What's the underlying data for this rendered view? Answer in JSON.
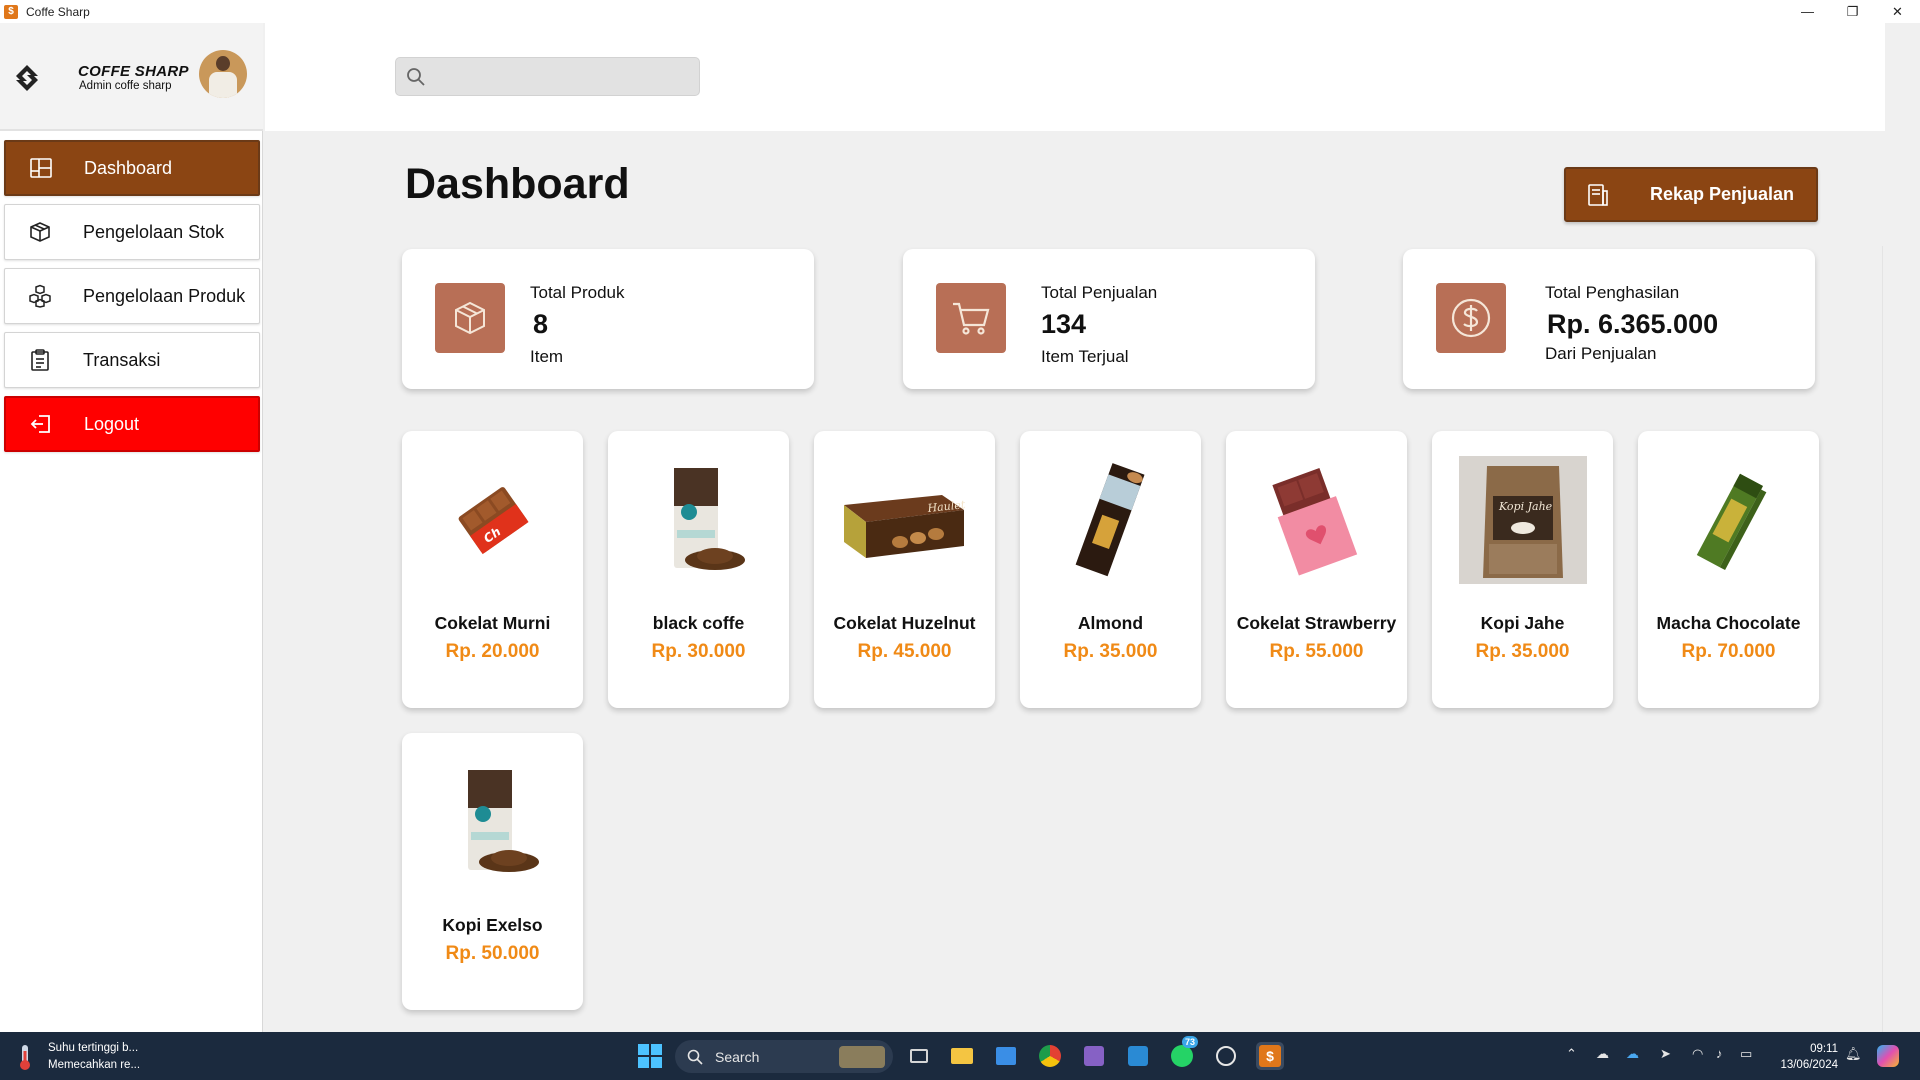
{
  "window": {
    "title": "Coffe Sharp",
    "minimize": "—",
    "maximize": "❐",
    "close": "✕"
  },
  "brand": {
    "name": "COFFE SHARP",
    "subtitle": "Admin coffe sharp"
  },
  "sidebar": {
    "items": [
      {
        "label": "Dashboard",
        "icon": "dashboard-icon",
        "active": true
      },
      {
        "label": "Pengelolaan Stok",
        "icon": "box-icon"
      },
      {
        "label": "Pengelolaan Produk",
        "icon": "boxes-icon"
      },
      {
        "label": "Transaksi",
        "icon": "clipboard-icon"
      },
      {
        "label": "Logout",
        "icon": "logout-icon"
      }
    ]
  },
  "search": {
    "value": "",
    "placeholder": ""
  },
  "page": {
    "title": "Dashboard",
    "rekap_label": "Rekap Penjualan"
  },
  "stats": [
    {
      "label": "Total Produk",
      "value": "8",
      "unit": "Item",
      "icon": "package-icon"
    },
    {
      "label": "Total Penjualan",
      "value": "134",
      "unit": "Item Terjual",
      "icon": "cart-icon"
    },
    {
      "label": "Total Penghasilan",
      "value": "Rp. 6.365.000",
      "unit": "Dari Penjualan",
      "icon": "dollar-icon"
    }
  ],
  "products": [
    {
      "name": "Cokelat Murni",
      "price": "Rp. 20.000"
    },
    {
      "name": "black coffe",
      "price": "Rp. 30.000"
    },
    {
      "name": "Cokelat Huzelnut",
      "price": "Rp. 45.000"
    },
    {
      "name": "Almond",
      "price": "Rp. 35.000"
    },
    {
      "name": "Cokelat Strawberry",
      "price": "Rp. 55.000"
    },
    {
      "name": "Kopi Jahe",
      "price": "Rp. 35.000"
    },
    {
      "name": "Macha Chocolate",
      "price": "Rp. 70.000"
    },
    {
      "name": "Kopi Exelso",
      "price": "Rp. 50.000"
    }
  ],
  "taskbar": {
    "weather_line1": "Suhu tertinggi b...",
    "weather_line2": "Memecahkan re...",
    "search_label": "Search",
    "whatsapp_badge": "73",
    "time": "09:11",
    "date": "13/06/2024"
  },
  "colors": {
    "accent": "#8b4513",
    "logout": "#ff0000",
    "price": "#f08a16",
    "stat_icon_bg": "#b86f56"
  }
}
